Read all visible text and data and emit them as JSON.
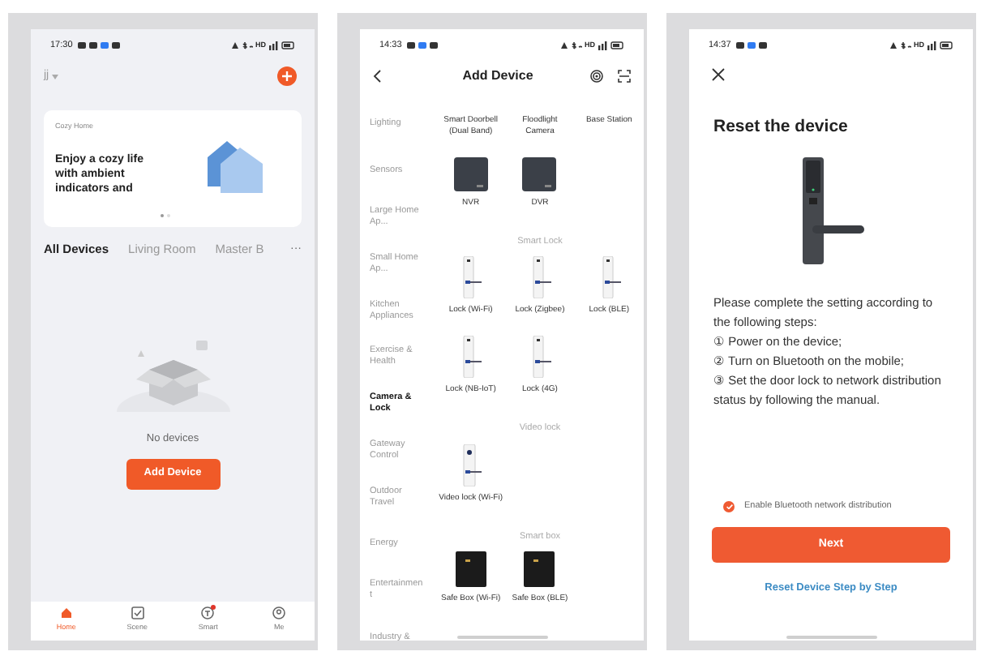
{
  "home_screen": {
    "status_time": "17:30",
    "network_label": "HD",
    "home_name": "jj",
    "banner": {
      "label": "Cozy Home",
      "headline": "Enjoy a cozy life with ambient indicators and",
      "dots": [
        {
          "selected": true
        },
        {
          "selected": false
        }
      ]
    },
    "tabs": [
      {
        "label": "All Devices",
        "selected": true
      },
      {
        "label": "Living Room",
        "selected": false
      },
      {
        "label": "Master B",
        "selected": false
      }
    ],
    "more": "···",
    "empty_text": "No devices",
    "add_button": "Add Device",
    "nav": [
      {
        "label": "Home",
        "kind": "home",
        "selected": true,
        "badge": false
      },
      {
        "label": "Scene",
        "kind": "scene",
        "selected": false,
        "badge": false
      },
      {
        "label": "Smart",
        "kind": "smart",
        "selected": false,
        "badge": true
      },
      {
        "label": "Me",
        "kind": "me",
        "selected": false,
        "badge": false
      }
    ]
  },
  "add_device_screen": {
    "status_time": "14:33",
    "network_label": "HD",
    "title": "Add Device",
    "categories": [
      {
        "label": "Lighting",
        "selected": false
      },
      {
        "label": "Sensors",
        "selected": false
      },
      {
        "label": "Large Home Ap...",
        "selected": false
      },
      {
        "label": "Small Home Ap...",
        "selected": false
      },
      {
        "label": "Kitchen Appliances",
        "selected": false
      },
      {
        "label": "Exercise & Health",
        "selected": false
      },
      {
        "label": "Camera & Lock",
        "selected": true
      },
      {
        "label": "Gateway Control",
        "selected": false
      },
      {
        "label": "Outdoor Travel",
        "selected": false
      },
      {
        "label": "Energy",
        "selected": false
      },
      {
        "label": "Entertainment",
        "selected": false
      },
      {
        "label": "Industry &",
        "selected": false
      }
    ],
    "sections": [
      {
        "items": [
          {
            "label": "Smart Doorbell (Dual Band)",
            "kind": "label_only"
          },
          {
            "label": "Floodlight Camera",
            "kind": "label_only"
          },
          {
            "label": "Base Station",
            "kind": "label_only"
          },
          {
            "label": "NVR",
            "kind": "recorder"
          },
          {
            "label": "DVR",
            "kind": "recorder"
          }
        ]
      },
      {
        "heading": "Smart Lock",
        "items": [
          {
            "label": "Lock (Wi-Fi)",
            "kind": "lock"
          },
          {
            "label": "Lock (Zigbee)",
            "kind": "lock"
          },
          {
            "label": "Lock (BLE)",
            "kind": "lock"
          },
          {
            "label": "Lock (NB-IoT)",
            "kind": "lock"
          },
          {
            "label": "Lock (4G)",
            "kind": "lock"
          }
        ]
      },
      {
        "heading": "Video lock",
        "items": [
          {
            "label": "Video lock (Wi-Fi)",
            "kind": "video_lock"
          }
        ]
      },
      {
        "heading": "Smart box",
        "items": [
          {
            "label": "Safe Box (Wi-Fi)",
            "kind": "safe"
          },
          {
            "label": "Safe Box (BLE)",
            "kind": "safe"
          }
        ]
      }
    ]
  },
  "reset_screen": {
    "status_time": "14:37",
    "network_label": "HD",
    "title": "Reset the device",
    "intro": "Please complete the setting according to the following steps:",
    "steps": [
      "① Power on the device;",
      "② Turn on Bluetooth on the mobile;",
      "③ Set the door lock to network distribution status by following the manual."
    ],
    "checkbox": {
      "label": "Enable Bluetooth network distribution",
      "checked": true
    },
    "next_button": "Next",
    "link": "Reset Device Step by Step"
  }
}
